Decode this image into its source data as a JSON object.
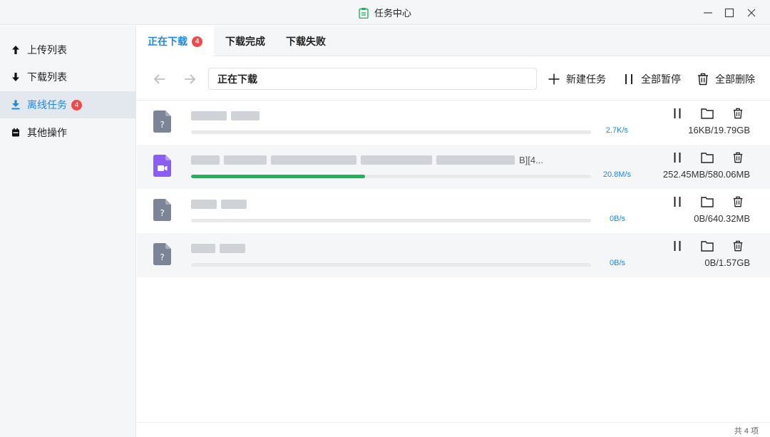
{
  "window": {
    "title": "任务中心"
  },
  "sidebar": {
    "items": [
      {
        "label": "上传列表",
        "icon": "arrow-up-icon"
      },
      {
        "label": "下载列表",
        "icon": "arrow-down-icon"
      },
      {
        "label": "离线任务",
        "icon": "offline-download-icon",
        "badge": "4",
        "active": true
      },
      {
        "label": "其他操作",
        "icon": "calendar-icon"
      }
    ]
  },
  "tabs": [
    {
      "label": "正在下载",
      "badge": "4",
      "active": true
    },
    {
      "label": "下载完成"
    },
    {
      "label": "下载失败"
    }
  ],
  "toolbar": {
    "path": "正在下载",
    "new_task": "新建任务",
    "pause_all": "全部暂停",
    "delete_all": "全部删除"
  },
  "tasks": [
    {
      "name_visible": "",
      "speed": "2.7K/s",
      "size": "16KB/19.79GB",
      "progress": 0.0,
      "icon": "unknown-file-icon"
    },
    {
      "name_visible": "B][4...",
      "speed": "20.8M/s",
      "size": "252.45MB/580.06MB",
      "progress": 0.435,
      "icon": "video-file-icon"
    },
    {
      "name_visible": "",
      "speed": "0B/s",
      "size": "0B/640.32MB",
      "progress": 0.0,
      "icon": "unknown-file-icon"
    },
    {
      "name_visible": "",
      "speed": "0B/s",
      "size": "0B/1.57GB",
      "progress": 0.0,
      "icon": "unknown-file-icon"
    }
  ],
  "footer": {
    "count": "共 4 项"
  },
  "colors": {
    "accent": "#1e88e5",
    "progress": "#1db35b",
    "badge": "#f24848",
    "video_icon": "#8b5cf6",
    "file_icon": "#7c8597"
  }
}
